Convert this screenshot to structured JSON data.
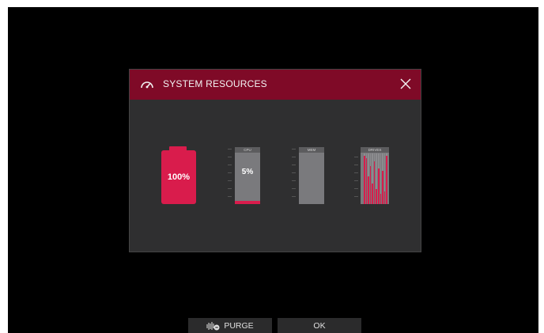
{
  "dialog": {
    "title": "SYSTEM RESOURCES",
    "icon": "gauge-icon",
    "close_icon": "close-icon"
  },
  "battery": {
    "label": "100%",
    "level": 100
  },
  "cpu": {
    "name": "CPU",
    "label": "5%",
    "level": 5
  },
  "mem": {
    "name": "MEM",
    "level": 0
  },
  "drives": {
    "name": "DRIVES",
    "levels": [
      95,
      90,
      55,
      75,
      40,
      85,
      30,
      70,
      20,
      65,
      25,
      95
    ]
  },
  "buttons": {
    "purge": {
      "label": "PURGE",
      "icon": "purge-icon"
    },
    "ok": {
      "label": "OK"
    }
  },
  "colors": {
    "accent": "#d91c4c",
    "header": "#7f0a27",
    "panel": "#2f2f30"
  }
}
